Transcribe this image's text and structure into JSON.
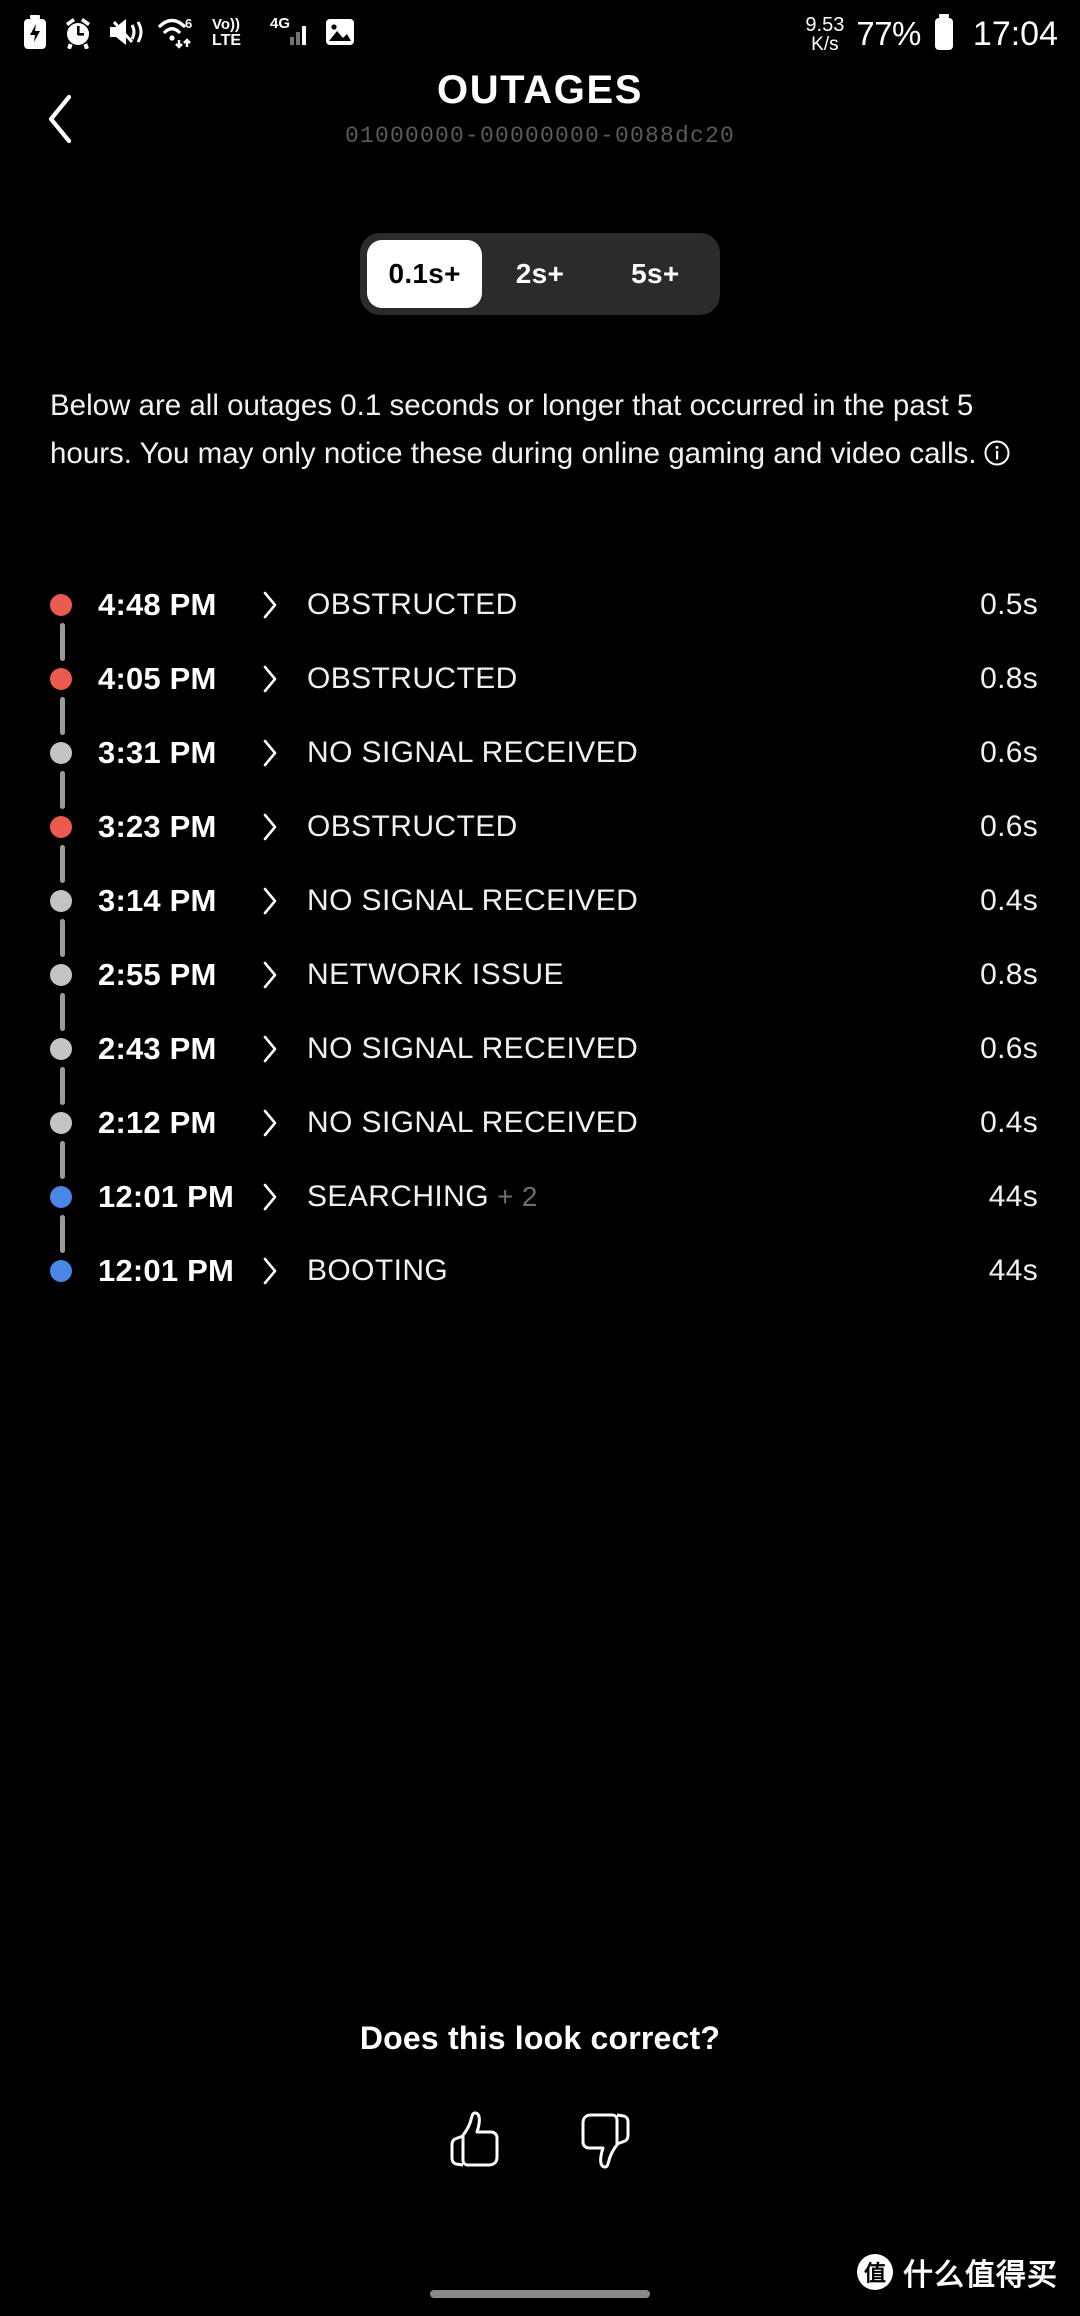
{
  "status_bar": {
    "left_icons": [
      "battery-saver-icon",
      "alarm-icon",
      "mute-vibrate-icon",
      "wifi-6-icon",
      "volte-icon",
      "signal-4g-icon",
      "photo-icon"
    ],
    "net_speed_value": "9.53",
    "net_speed_unit": "K/s",
    "battery_percent": "77%",
    "clock": "17:04"
  },
  "header": {
    "back_icon": "chevron-left-icon",
    "title": "OUTAGES",
    "subtitle": "01000000-00000000-0088dc20"
  },
  "segmented": {
    "options": [
      {
        "label": "0.1s+",
        "selected": true
      },
      {
        "label": "2s+",
        "selected": false
      },
      {
        "label": "5s+",
        "selected": false
      }
    ]
  },
  "description": {
    "text": "Below are all outages 0.1 seconds or longer that occurred in the past 5 hours. You may only notice these during online gaming and video calls.",
    "info_icon": "info-icon"
  },
  "colors": {
    "obstructed": "#ea5a4e",
    "no_signal": "#c4c4c4",
    "network_issue": "#c4c4c4",
    "searching": "#4a86e8",
    "booting": "#4a86e8",
    "connector": "#9b9b9b",
    "accent_selected_bg": "#ffffff",
    "segment_track": "#2b2b2b"
  },
  "outages": [
    {
      "time": "4:48 PM",
      "reason": "OBSTRUCTED",
      "extra": "",
      "duration": "0.5s",
      "dot": "obstructed"
    },
    {
      "time": "4:05 PM",
      "reason": "OBSTRUCTED",
      "extra": "",
      "duration": "0.8s",
      "dot": "obstructed"
    },
    {
      "time": "3:31 PM",
      "reason": "NO SIGNAL RECEIVED",
      "extra": "",
      "duration": "0.6s",
      "dot": "no_signal"
    },
    {
      "time": "3:23 PM",
      "reason": "OBSTRUCTED",
      "extra": "",
      "duration": "0.6s",
      "dot": "obstructed"
    },
    {
      "time": "3:14 PM",
      "reason": "NO SIGNAL RECEIVED",
      "extra": "",
      "duration": "0.4s",
      "dot": "no_signal"
    },
    {
      "time": "2:55 PM",
      "reason": "NETWORK ISSUE",
      "extra": "",
      "duration": "0.8s",
      "dot": "network_issue"
    },
    {
      "time": "2:43 PM",
      "reason": "NO SIGNAL RECEIVED",
      "extra": "",
      "duration": "0.6s",
      "dot": "no_signal"
    },
    {
      "time": "2:12 PM",
      "reason": "NO SIGNAL RECEIVED",
      "extra": "",
      "duration": "0.4s",
      "dot": "no_signal"
    },
    {
      "time": "12:01 PM",
      "reason": "SEARCHING",
      "extra": "+ 2",
      "duration": "44s",
      "dot": "searching"
    },
    {
      "time": "12:01 PM",
      "reason": "BOOTING",
      "extra": "",
      "duration": "44s",
      "dot": "booting"
    }
  ],
  "row_chevron_icon": "chevron-right-icon",
  "feedback": {
    "question": "Does this look correct?",
    "thumbs_up_icon": "thumbs-up-icon",
    "thumbs_down_icon": "thumbs-down-icon"
  },
  "watermark": {
    "logo_char": "值",
    "text": "什么值得买"
  }
}
